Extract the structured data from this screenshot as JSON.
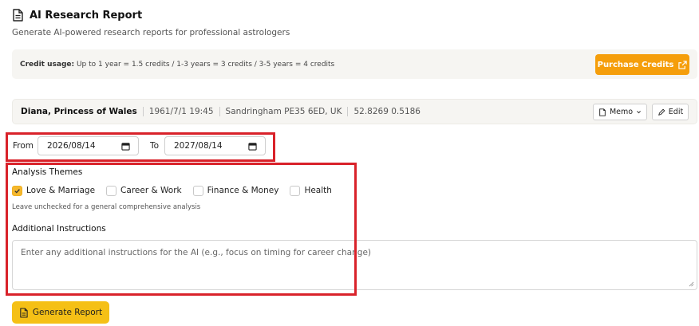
{
  "header": {
    "title": "AI Research Report",
    "subtitle": "Generate AI-powered research reports for professional astrologers",
    "title_icon": "document-icon"
  },
  "credits": {
    "label": "Credit usage:",
    "text": "Up to 1 year = 1.5 credits / 1-3 years = 3 credits / 3-5 years = 4 credits",
    "purchase_label": "Purchase Credits",
    "purchase_icon": "external-link-icon",
    "accent_color": "#f59e0b"
  },
  "profile": {
    "name": "Diana, Princess of Wales",
    "datetime": "1961/7/1 19:45",
    "location": "Sandringham PE35 6ED, UK",
    "coords": "52.8269 0.5186",
    "memo_label": "Memo",
    "edit_label": "Edit"
  },
  "dates": {
    "from_label": "From",
    "from_value": "2026/08/14",
    "to_label": "To",
    "to_value": "2027/08/14"
  },
  "themes": {
    "label": "Analysis Themes",
    "items": [
      {
        "label": "Love & Marriage",
        "checked": true
      },
      {
        "label": "Career & Work",
        "checked": false
      },
      {
        "label": "Finance & Money",
        "checked": false
      },
      {
        "label": "Health",
        "checked": false
      }
    ],
    "hint": "Leave unchecked for a general comprehensive analysis"
  },
  "instructions": {
    "label": "Additional Instructions",
    "placeholder": "Enter any additional instructions for the AI (e.g., focus on timing for career change)"
  },
  "generate": {
    "label": "Generate Report",
    "color": "#f5c016"
  },
  "highlight_color": "#d9222a"
}
